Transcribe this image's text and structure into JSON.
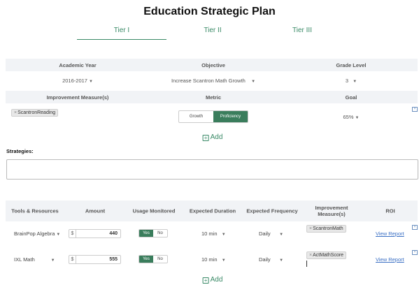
{
  "page_title": "Education Strategic Plan",
  "tabs": [
    "Tier I",
    "Tier II",
    "Tier III"
  ],
  "headers1": [
    "Academic Year",
    "Objective",
    "Grade Level"
  ],
  "row1": {
    "academic_year": "2016-2017",
    "objective": "Increase Scantron Math Growth",
    "grade_level": "3"
  },
  "headers2": [
    "Improvement Measure(s)",
    "Metric",
    "Goal"
  ],
  "row2": {
    "measure_tag": "ScantronReading",
    "metric_options": [
      "Growth",
      "Proficiency"
    ],
    "metric_selected": "Proficiency",
    "goal": "65%"
  },
  "add_label": "Add",
  "strategies_label": "Strategies:",
  "strategies_value": "",
  "table": {
    "headers": [
      "Tools & Resources",
      "Amount",
      "Usage Monitored",
      "Expected Duration",
      "Expected Frequency",
      "Improvement Measure(s)",
      "ROI"
    ],
    "rows": [
      {
        "tool": "BrainPop Algebra",
        "currency": "$",
        "amount": "440",
        "usage_yes": "Yes",
        "usage_no": "No",
        "duration": "10 min",
        "frequency": "Daily",
        "measure": "ScantronMath",
        "roi": "View Report"
      },
      {
        "tool": "IXL Math",
        "currency": "$",
        "amount": "555",
        "usage_yes": "Yes",
        "usage_no": "No",
        "duration": "10 min",
        "frequency": "Daily",
        "measure": "ActMathScore",
        "roi": "View Report"
      }
    ]
  },
  "colors": {
    "accent": "#3a7d5c",
    "link": "#3a6fc4",
    "band": "#f1f3f6"
  }
}
